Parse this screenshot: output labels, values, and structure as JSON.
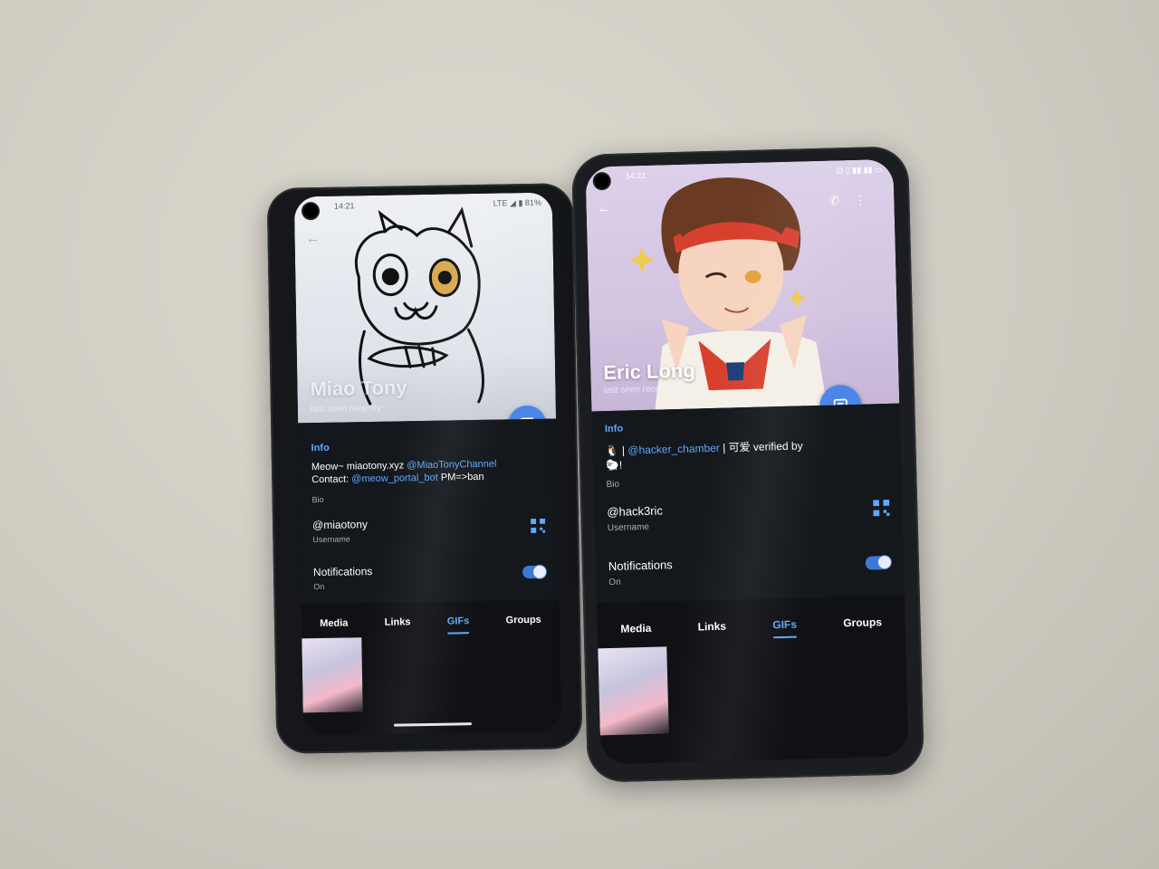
{
  "phone_left": {
    "status": {
      "time": "14:21",
      "network": "LTE",
      "battery": "81%"
    },
    "name": "Miao Tony",
    "last_seen": "last seen recently",
    "info_title": "Info",
    "bio_text_1": "Meow~ miaotony.xyz ",
    "bio_link_1": "@MiaoTonyChannel",
    "bio_text_2": "Contact: ",
    "bio_link_2": "@meow_portal_bot",
    "bio_text_3": " PM=>ban",
    "bio_caption": "Bio",
    "username": "@miaotony",
    "username_caption": "Username",
    "notifications_label": "Notifications",
    "notifications_state": "On",
    "tabs": [
      "Media",
      "Links",
      "GIFs",
      "Groups"
    ],
    "active_tab": "GIFs"
  },
  "phone_right": {
    "status": {
      "time": "14:21"
    },
    "name": "Eric Long",
    "last_seen": "last seen recently",
    "info_title": "Info",
    "bio_prefix": "| ",
    "bio_link": "@hacker_chamber",
    "bio_text": " | 可爱 verified by",
    "bio_text_2": "!",
    "bio_caption": "Bio",
    "username": "@hack3ric",
    "username_caption": "Username",
    "notifications_label": "Notifications",
    "notifications_state": "On",
    "tabs": [
      "Media",
      "Links",
      "GIFs",
      "Groups"
    ],
    "active_tab": "GIFs"
  },
  "colors": {
    "accent": "#5fa8ff",
    "fab": "#4a86e8",
    "dark_bg": "#14171c"
  }
}
